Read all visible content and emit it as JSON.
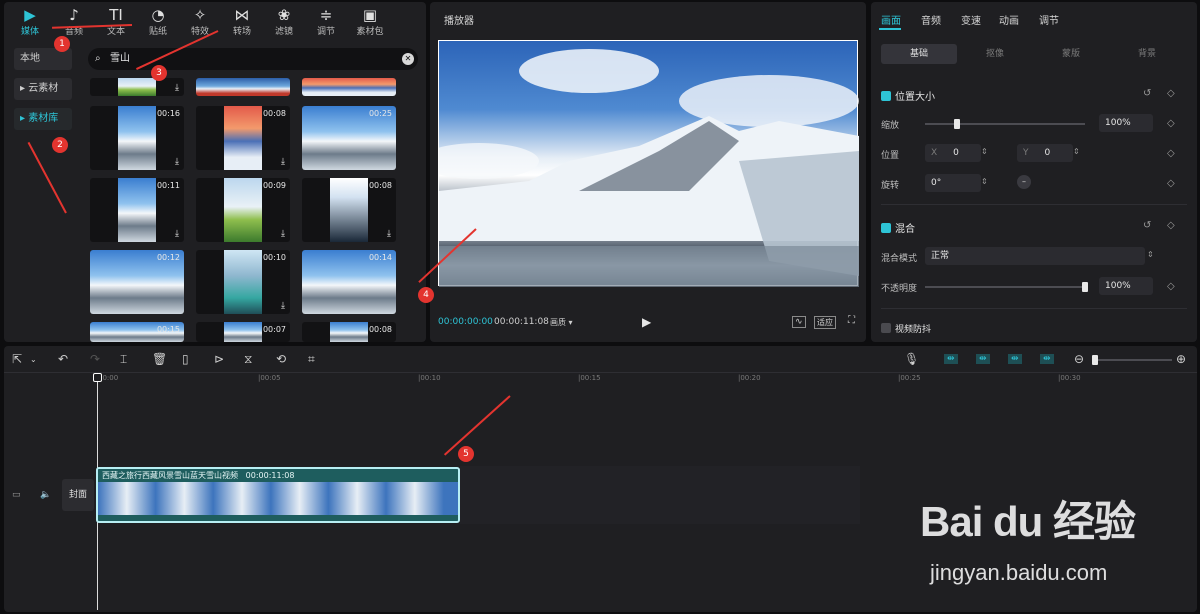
{
  "left_panel": {
    "tabs": [
      {
        "label": "媒体",
        "icon": "play-square-icon",
        "glyph": "▶"
      },
      {
        "label": "音频",
        "icon": "music-note-icon",
        "glyph": "♪"
      },
      {
        "label": "文本",
        "icon": "text-icon",
        "glyph": "TI"
      },
      {
        "label": "贴纸",
        "icon": "sticker-icon",
        "glyph": "◔"
      },
      {
        "label": "特效",
        "icon": "sparkle-icon",
        "glyph": "✧"
      },
      {
        "label": "转场",
        "icon": "transition-icon",
        "glyph": "⋈"
      },
      {
        "label": "滤镜",
        "icon": "filter-icon",
        "glyph": "❀"
      },
      {
        "label": "调节",
        "icon": "sliders-icon",
        "glyph": "≑"
      },
      {
        "label": "素材包",
        "icon": "package-icon",
        "glyph": "▣"
      }
    ],
    "side_buttons": [
      "本地",
      "▸ 云素材",
      "▸ 素材库"
    ],
    "search_value": "雪山",
    "thumbnails": [
      {
        "duration": "00:16"
      },
      {
        "duration": "00:08"
      },
      {
        "duration": "00:25"
      },
      {
        "duration": "00:11"
      },
      {
        "duration": "00:09"
      },
      {
        "duration": "00:08"
      },
      {
        "duration": "00:12"
      },
      {
        "duration": "00:10"
      },
      {
        "duration": "00:14"
      },
      {
        "duration": "00:15"
      },
      {
        "duration": "00:07"
      },
      {
        "duration": "00:08"
      }
    ]
  },
  "player": {
    "title": "播放器",
    "current_time": "00:00:00:00",
    "total_time": "00:00:11:08",
    "quality_label": "画质 ▾",
    "ratio_label": "适应"
  },
  "right_panel": {
    "tabs": [
      "画面",
      "音频",
      "变速",
      "动画",
      "调节"
    ],
    "subtabs": [
      "基础",
      "抠像",
      "蒙版",
      "背景"
    ],
    "position_size": {
      "header": "位置大小",
      "scale_label": "缩放",
      "scale_value": "100%",
      "scale_fraction": 0.2,
      "position_label": "位置",
      "x_label": "X",
      "x_value": "0",
      "y_label": "Y",
      "y_value": "0",
      "rotate_label": "旋转",
      "rotate_value": "0°"
    },
    "blend": {
      "header": "混合",
      "mode_label": "混合模式",
      "mode_value": "正常",
      "opacity_label": "不透明度",
      "opacity_value": "100%",
      "opacity_fraction": 1.0
    },
    "stabilize_label": "视频防抖"
  },
  "timeline": {
    "ruler": [
      "00:00",
      "|00:05",
      "|00:10",
      "|00:15",
      "|00:20",
      "|00:25",
      "|00:30"
    ],
    "cover_label": "封面",
    "clip_title": "西藏之旅行西藏风景雪山蓝天雪山视频",
    "clip_duration": "00:00:11:08"
  },
  "annotations": [
    "1",
    "2",
    "3",
    "4",
    "5"
  ],
  "watermark": {
    "brand": "Bai du 经验",
    "url": "jingyan.baidu.com"
  },
  "colors": {
    "accent": "#2ec4d6",
    "annotation": "#e3342f",
    "panel": "#1f1f22",
    "background": "#0d0d0f"
  }
}
